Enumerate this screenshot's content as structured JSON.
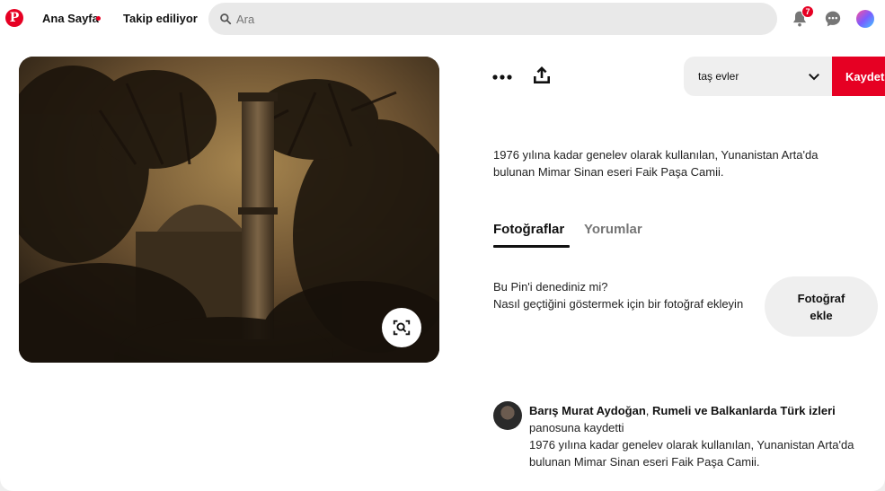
{
  "nav": {
    "logo": "P",
    "home": "Ana Sayfa",
    "following": "Takip ediliyor",
    "search_placeholder": "Ara",
    "notification_count": "7"
  },
  "pin": {
    "board": "taş evler",
    "save_label": "Kaydet",
    "description": "1976 yılına kadar genelev olarak kullanılan, Yunanistan Arta'da bulunan Mimar Sinan eseri Faik Paşa Camii.",
    "tabs": [
      "Fotoğraflar",
      "Yorumlar"
    ],
    "tried_title": "Bu Pin'i denediniz mi?",
    "tried_text": "Nasıl geçtiğini göstermek için bir fotoğraf ekleyin",
    "add_photo_label": "Fotoğraf ekle"
  },
  "saver": {
    "name": "Barış Murat Aydoğan",
    "separator": ", ",
    "board_name": "Rumeli ve Balkanlarda Türk izleri",
    "action": "panosuna kaydetti",
    "caption": "1976 yılına kadar genelev olarak kullanılan, Yunanistan Arta'da bulunan Mimar Sinan eseri Faik Paşa Camii."
  },
  "colors": {
    "brand": "#e60023",
    "tab_active": "#111111",
    "tab_inactive": "#767676"
  },
  "icons": [
    "pinterest-logo-icon",
    "search-icon",
    "bell-icon",
    "chat-icon",
    "more-icon",
    "share-icon",
    "chevron-down-icon",
    "visual-search-icon"
  ]
}
